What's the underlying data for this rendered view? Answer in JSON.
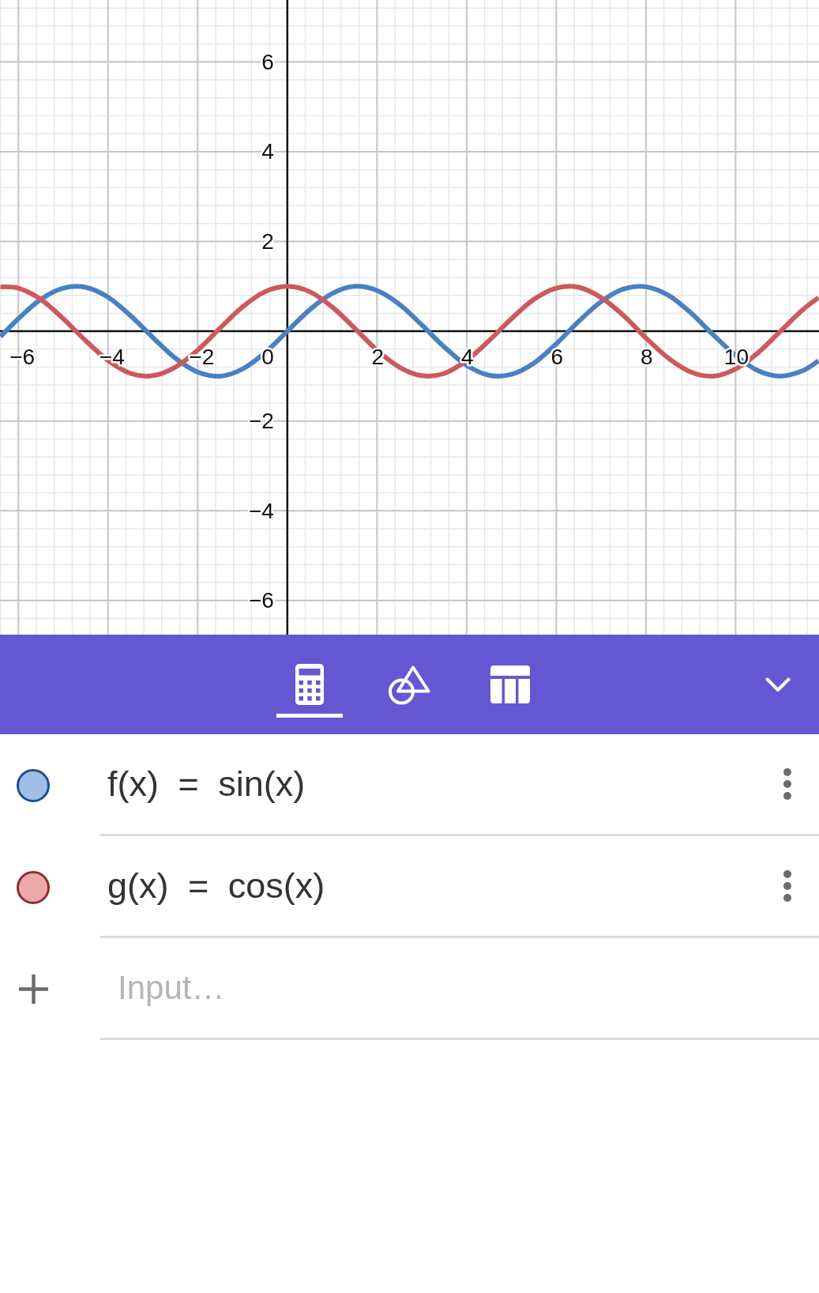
{
  "graph": {
    "origin_label": "0",
    "chart_data": {
      "type": "line",
      "grid": true,
      "x": [
        -6.4,
        -6,
        -5.5,
        -5,
        -4.5,
        -4,
        -3.5,
        -3,
        -2.5,
        -2,
        -1.5,
        -1,
        -0.5,
        0,
        0.5,
        1,
        1.5,
        2,
        2.5,
        3,
        3.5,
        4,
        4.5,
        5,
        5.5,
        6,
        6.5,
        7,
        7.5,
        8,
        8.5,
        9,
        9.5,
        10,
        10.5,
        11,
        11.5,
        11.85
      ],
      "series": [
        {
          "color": "#4a80c4",
          "values": [
            -0.12,
            0.28,
            0.71,
            0.96,
            0.98,
            0.76,
            0.35,
            -0.14,
            -0.6,
            -0.91,
            -1,
            -0.84,
            -0.48,
            0,
            0.48,
            0.84,
            1,
            0.91,
            0.6,
            0.14,
            -0.35,
            -0.76,
            -0.98,
            -0.96,
            -0.71,
            -0.28,
            0.22,
            0.66,
            0.94,
            0.99,
            0.8,
            0.41,
            -0.08,
            -0.54,
            -0.88,
            -1,
            -0.88,
            -0.66
          ]
        },
        {
          "color": "#cc5a5c",
          "values": [
            0.99,
            0.96,
            0.71,
            0.28,
            -0.21,
            -0.65,
            -0.94,
            -0.99,
            -0.8,
            -0.42,
            0.07,
            0.54,
            0.88,
            1,
            0.88,
            0.54,
            0.07,
            -0.42,
            -0.8,
            -0.99,
            -0.94,
            -0.65,
            -0.21,
            0.28,
            0.71,
            0.96,
            0.98,
            0.75,
            0.35,
            -0.15,
            -0.6,
            -0.91,
            -1,
            -0.84,
            -0.48,
            0,
            0.48,
            0.75
          ]
        }
      ],
      "xlim": [
        -6.41,
        11.86
      ],
      "ylim": [
        -6.76,
        7.38
      ],
      "xticks": [
        {
          "value": -6,
          "label": "−6"
        },
        {
          "value": -4,
          "label": "−4"
        },
        {
          "value": -2,
          "label": "−2"
        },
        {
          "value": 2,
          "label": "2"
        },
        {
          "value": 4,
          "label": "4"
        },
        {
          "value": 6,
          "label": "6"
        },
        {
          "value": 8,
          "label": "8"
        },
        {
          "value": 10,
          "label": "10"
        }
      ],
      "yticks": [
        {
          "value": -6,
          "label": "−6"
        },
        {
          "value": -4,
          "label": "−4"
        },
        {
          "value": -2,
          "label": "−2"
        },
        {
          "value": 2,
          "label": "2"
        },
        {
          "value": 4,
          "label": "4"
        },
        {
          "value": 6,
          "label": "6"
        }
      ]
    }
  },
  "toolbar": {
    "tabs": [
      {
        "kind": "algebra",
        "selected": true
      },
      {
        "kind": "tools",
        "selected": false
      },
      {
        "kind": "table",
        "selected": false
      }
    ]
  },
  "algebra": {
    "items": [
      {
        "expression": "f(x) = sin(x)",
        "color": "#a0bfe8",
        "visible": true
      },
      {
        "expression": "g(x) = cos(x)",
        "color": "#eba9a9",
        "visible": true
      }
    ],
    "input": {
      "placeholder": "Input…"
    }
  }
}
